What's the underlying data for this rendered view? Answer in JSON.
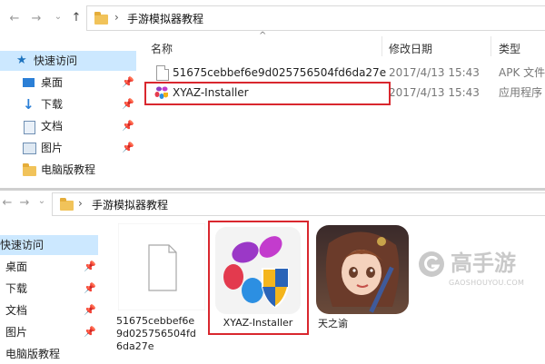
{
  "top": {
    "nav": {
      "back": "←",
      "forward": "→",
      "up": "↑"
    },
    "breadcrumb": {
      "separator": "›",
      "folder": "手游模拟器教程"
    },
    "sidebar": {
      "items": [
        {
          "label": "快速访问",
          "pinned": false
        },
        {
          "label": "桌面",
          "pinned": true
        },
        {
          "label": "下载",
          "pinned": true
        },
        {
          "label": "文档",
          "pinned": true
        },
        {
          "label": "图片",
          "pinned": true
        },
        {
          "label": "电脑版教程",
          "pinned": false
        }
      ]
    },
    "columns": {
      "name": "名称",
      "date": "修改日期",
      "type": "类型"
    },
    "files": [
      {
        "name": "51675cebbef6e9d025756504fd6da27e",
        "date": "2017/4/13 15:43",
        "type": "APK 文件"
      },
      {
        "name": "XYAZ-Installer",
        "date": "2017/4/13 15:43",
        "type": "应用程序"
      }
    ]
  },
  "bottom": {
    "nav": {
      "back": "←",
      "forward": "→",
      "up": "↑"
    },
    "breadcrumb": {
      "separator": "›",
      "folder": "手游模拟器教程"
    },
    "sidebar": {
      "items": [
        {
          "label": "快速访问"
        },
        {
          "label": "桌面",
          "pinned": true
        },
        {
          "label": "下载",
          "pinned": true
        },
        {
          "label": "文档",
          "pinned": true
        },
        {
          "label": "图片",
          "pinned": true
        },
        {
          "label": "电脑版教程"
        }
      ]
    },
    "tiles": [
      {
        "line1": "51675cebbef6e",
        "line2": "9d025756504fd",
        "line3": "6da27e"
      },
      {
        "line1": "XYAZ-Installer"
      },
      {
        "line1": "天之谕"
      }
    ],
    "watermark": {
      "brand": "高手游",
      "url": "GAOSHOUYOU.COM"
    }
  },
  "colors": {
    "highlight": "#d9272e",
    "selection": "#cce8ff",
    "hover": "#e5f3ff",
    "folder": "#f1c35a"
  }
}
